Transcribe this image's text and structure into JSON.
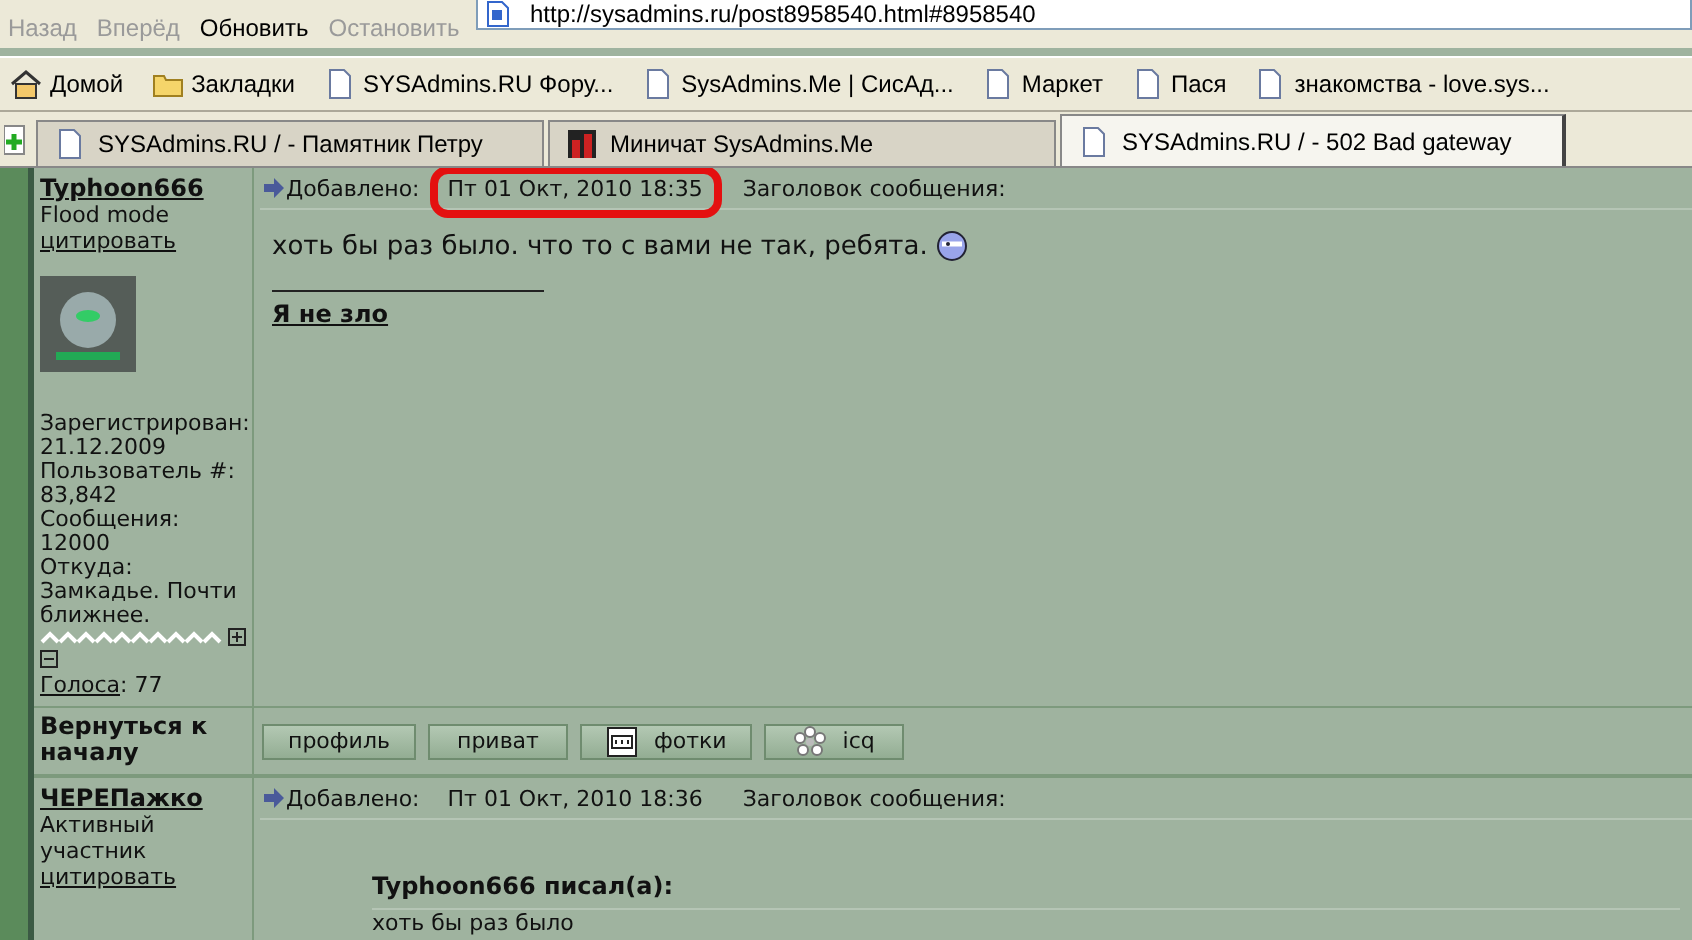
{
  "toolbar": {
    "buttons": [
      {
        "label": "Назад",
        "disabled": true
      },
      {
        "label": "Вперёд",
        "disabled": true
      },
      {
        "label": "Обновить",
        "disabled": false
      },
      {
        "label": "Остановить",
        "disabled": true
      }
    ],
    "address": "http://sysadmins.ru/post8958540.html#8958540"
  },
  "bookmarks": [
    {
      "label": "Домой",
      "kind": "home"
    },
    {
      "label": "Закладки",
      "kind": "folder"
    },
    {
      "label": "SYSAdmins.RU Фору...",
      "kind": "page"
    },
    {
      "label": "SysAdmins.Me | СисАд...",
      "kind": "page"
    },
    {
      "label": "Маркет",
      "kind": "page"
    },
    {
      "label": "Пася",
      "kind": "page"
    },
    {
      "label": "знакомства - love.sys...",
      "kind": "page"
    }
  ],
  "tabs": [
    {
      "title": "SYSAdmins.RU / - Памятник Петру",
      "kind": "page",
      "selected": false
    },
    {
      "title": "Миничат SysAdmins.Me",
      "kind": "app",
      "selected": false
    },
    {
      "title": "SYSAdmins.RU / - 502 Bad gateway",
      "kind": "page",
      "selected": true
    }
  ],
  "posts": [
    {
      "author": "Typhoon666",
      "rank": "Flood mode",
      "quote_link": "цитировать",
      "avatar": true,
      "profile": [
        "Зарегистрирован:",
        "21.12.2009",
        "Пользователь #:",
        "83,842",
        "Сообщения:",
        "12000",
        "Откуда:",
        "Замкадье. Почти ближнее."
      ],
      "votes_label": "Голоса",
      "votes_value": ": 77",
      "added_label": "Добавлено:",
      "added_date": "Пт 01 Окт, 2010 18:35",
      "highlighted": true,
      "subject_label": "Заголовок сообщения:",
      "text": "хоть бы раз было. что то с вами не так, ребята.",
      "smiley": true,
      "signature": "Я не зло"
    },
    {
      "author": "ЧЕРЕПажко",
      "rank": "Активный участник",
      "quote_link": "цитировать",
      "avatar": false,
      "added_label": "Добавлено:",
      "added_date": "Пт 01 Окт, 2010 18:36",
      "highlighted": false,
      "subject_label": "Заголовок сообщения:",
      "quote": {
        "author": "Typhoon666 писал(а):",
        "text": "хоть бы раз было"
      }
    }
  ],
  "back_to_top": "Вернуться к началу",
  "post_buttons": [
    {
      "label": "профиль",
      "kind": "plain"
    },
    {
      "label": "приват",
      "kind": "plain"
    },
    {
      "label": "фотки",
      "kind": "photos"
    },
    {
      "label": "icq",
      "kind": "icq"
    }
  ]
}
